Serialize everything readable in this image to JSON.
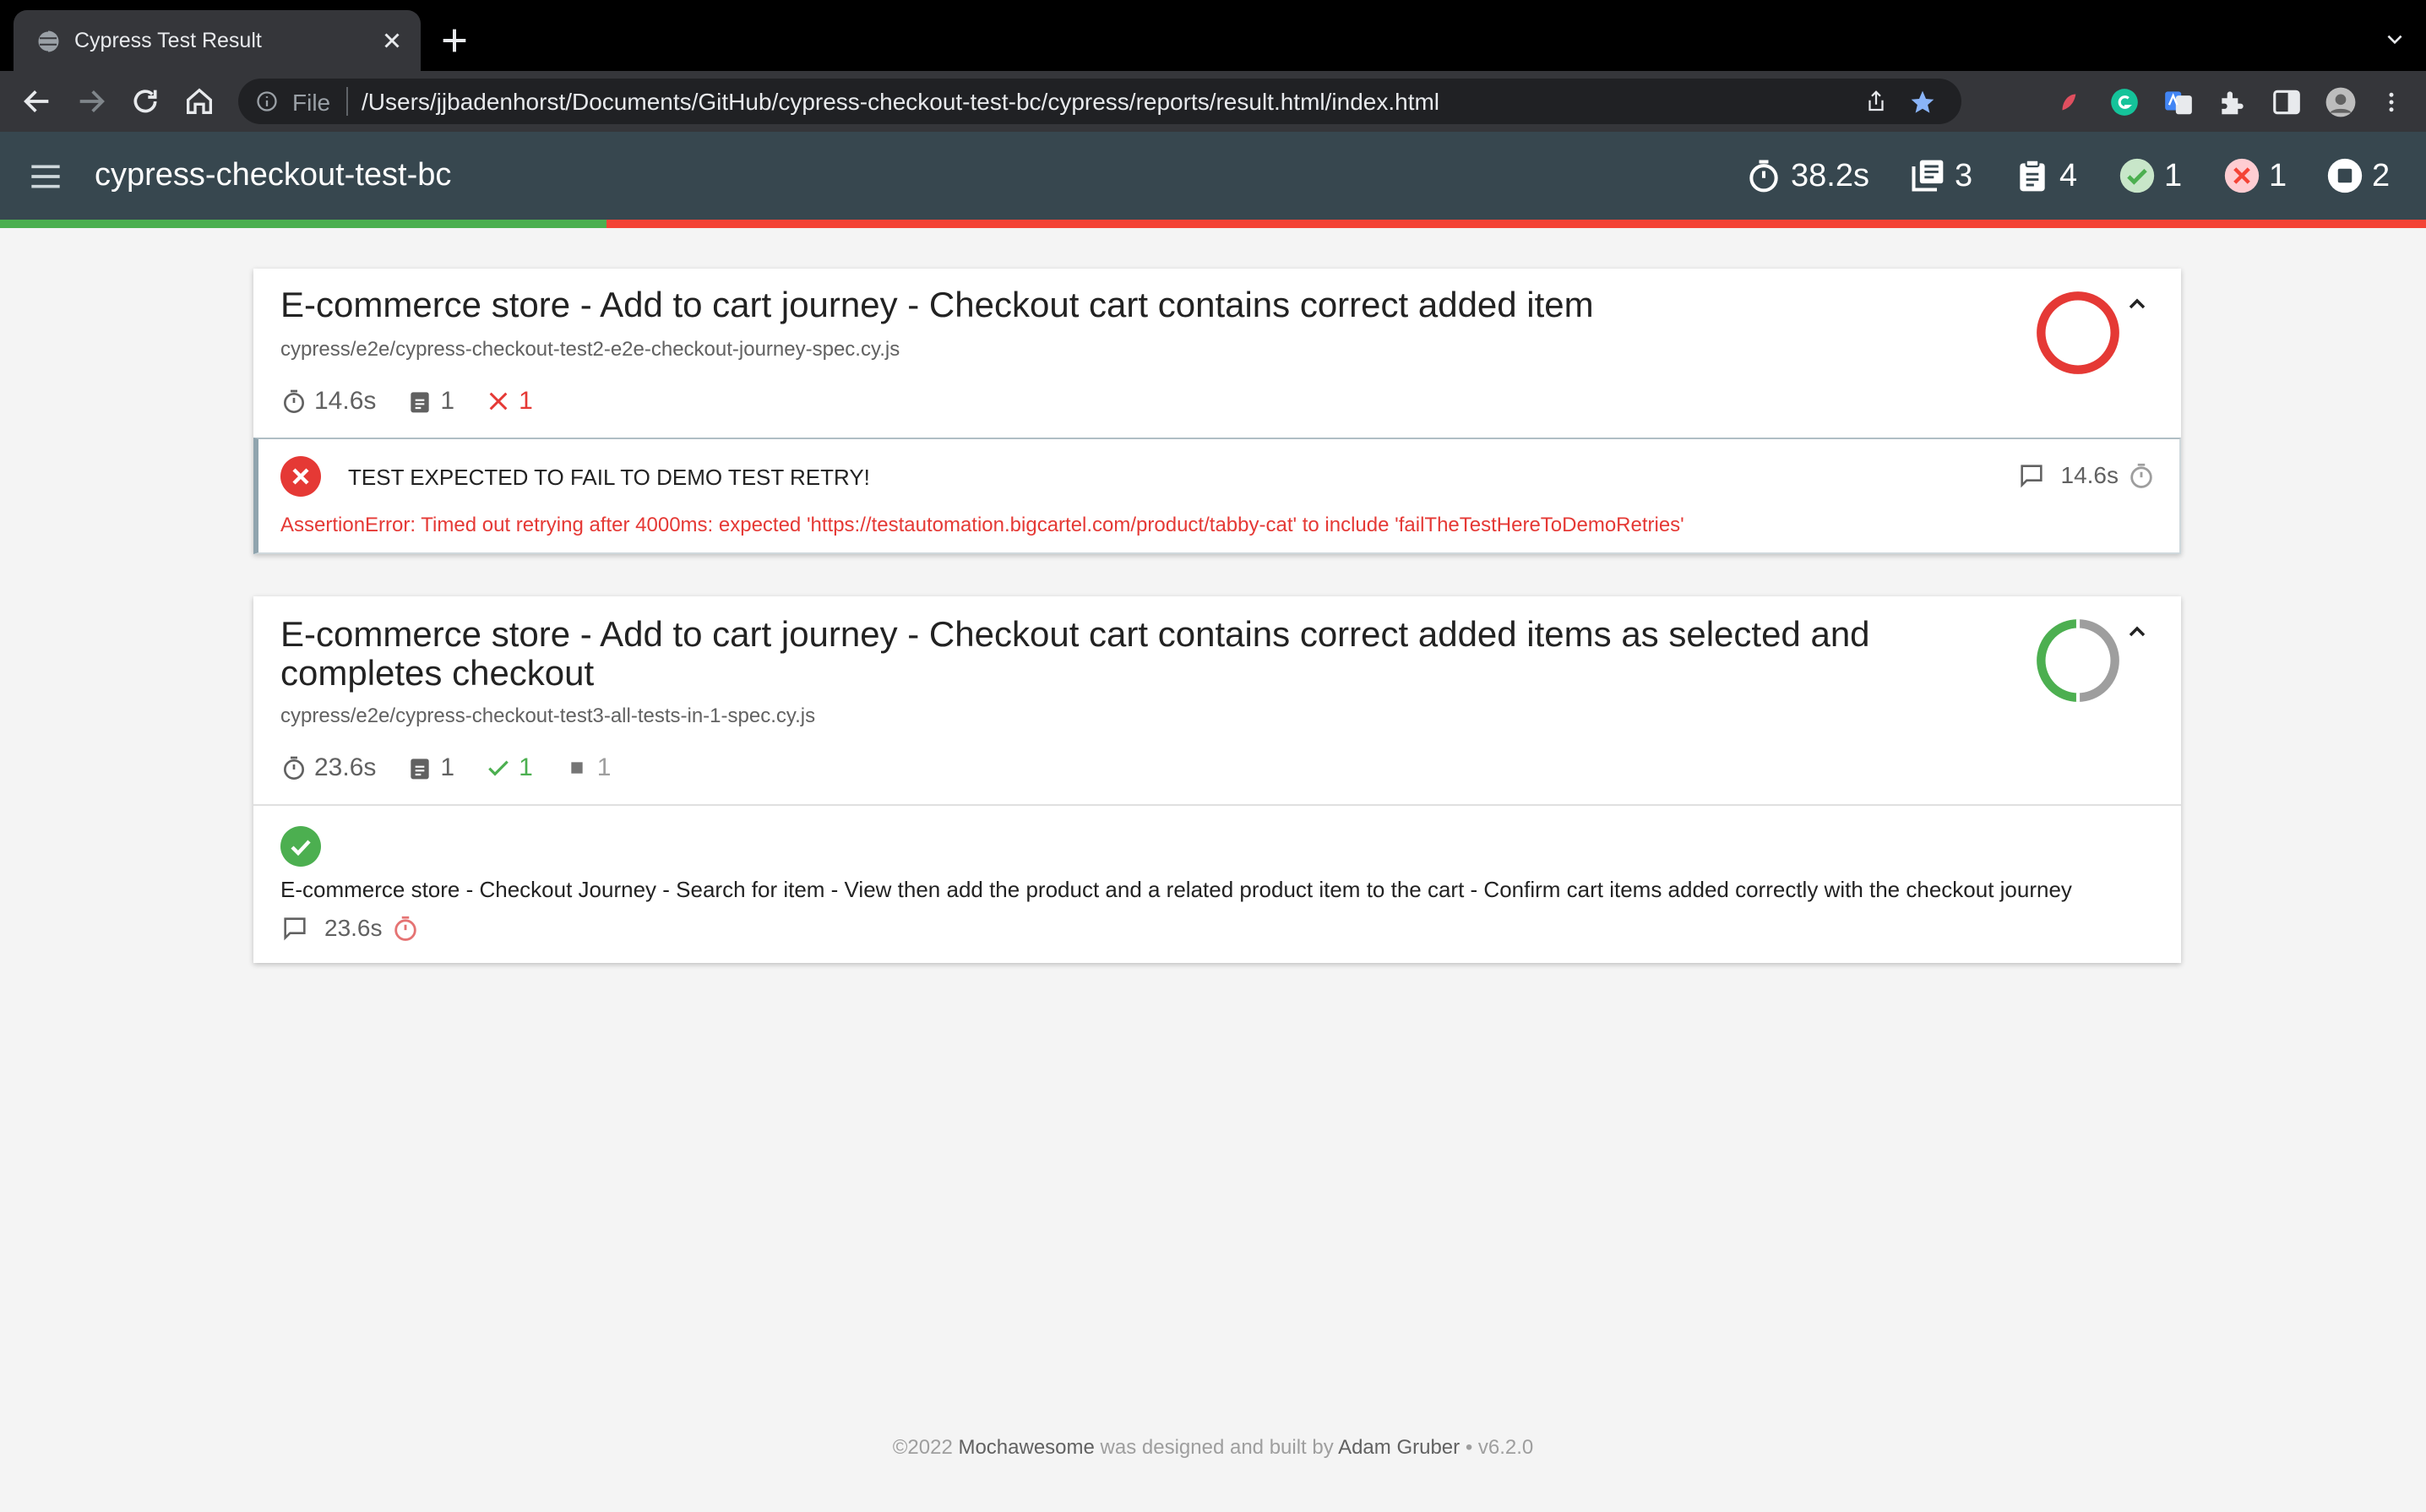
{
  "browser": {
    "tab_title": "Cypress Test Result",
    "scheme_label": "File",
    "url": "/Users/jjbadenhorst/Documents/GitHub/cypress-checkout-test-bc/cypress/reports/result.html/index.html"
  },
  "report": {
    "title": "cypress-checkout-test-bc",
    "stats": {
      "duration": "38.2s",
      "suites": "3",
      "tests": "4",
      "passed": "1",
      "failed": "1",
      "skipped": "2"
    },
    "pass_ratio": 0.25
  },
  "suites": [
    {
      "title": "E-commerce store - Add to cart journey - Checkout cart contains correct added item",
      "file": "cypress/e2e/cypress-checkout-test2-e2e-checkout-journey-spec.cy.js",
      "duration": "14.6s",
      "tests": "1",
      "failed": "1",
      "test": {
        "title": "TEST EXPECTED TO FAIL TO DEMO TEST RETRY!",
        "error": "AssertionError: Timed out retrying after 4000ms: expected 'https://testautomation.bigcartel.com/product/tabby-cat' to include 'failTheTestHereToDemoRetries'",
        "duration": "14.6s",
        "status": "failed"
      }
    },
    {
      "title_line1": "E-commerce store - Add to cart journey - Checkout cart contains correct added items as selected and",
      "title_line2": "completes checkout",
      "file": "cypress/e2e/cypress-checkout-test3-all-tests-in-1-spec.cy.js",
      "duration": "23.6s",
      "tests": "1",
      "passed": "1",
      "skipped": "1",
      "test": {
        "title": "E-commerce store - Checkout Journey - Search for item - View then add the product and a related product item to the cart - Confirm cart items added correctly with the checkout journey",
        "duration": "23.6s",
        "status": "passed"
      }
    }
  ],
  "footer": {
    "prefix": "©2022",
    "brand": "Mochawesome",
    "middle": "was designed and built by",
    "author": "Adam Gruber",
    "version": "• v6.2.0"
  },
  "colors": {
    "appbar": "#37474f",
    "pass": "#4caf50",
    "fail": "#f44336",
    "skip": "#9e9e9e"
  }
}
